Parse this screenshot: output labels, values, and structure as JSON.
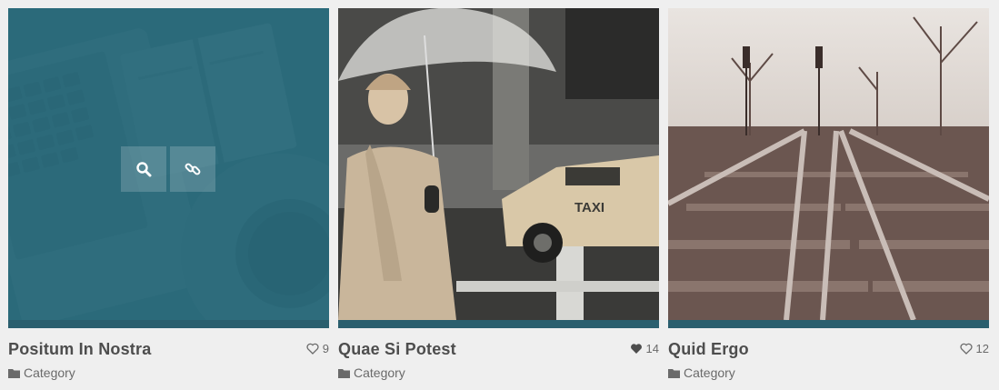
{
  "items": [
    {
      "title": "Positum In Nostra",
      "likes": "9",
      "category": "Category",
      "liked": false,
      "hovered": true,
      "actions": [
        {
          "icon": "search-icon"
        },
        {
          "icon": "link-icon"
        }
      ]
    },
    {
      "title": "Quae Si Potest",
      "likes": "14",
      "category": "Category",
      "liked": true,
      "hovered": false
    },
    {
      "title": "Quid Ergo",
      "likes": "12",
      "category": "Category",
      "liked": false,
      "hovered": false
    }
  ],
  "colors": {
    "accent": "#2b5f6e",
    "overlay": "#2a6878",
    "background": "#efefef",
    "text": "#4d4d4d"
  }
}
